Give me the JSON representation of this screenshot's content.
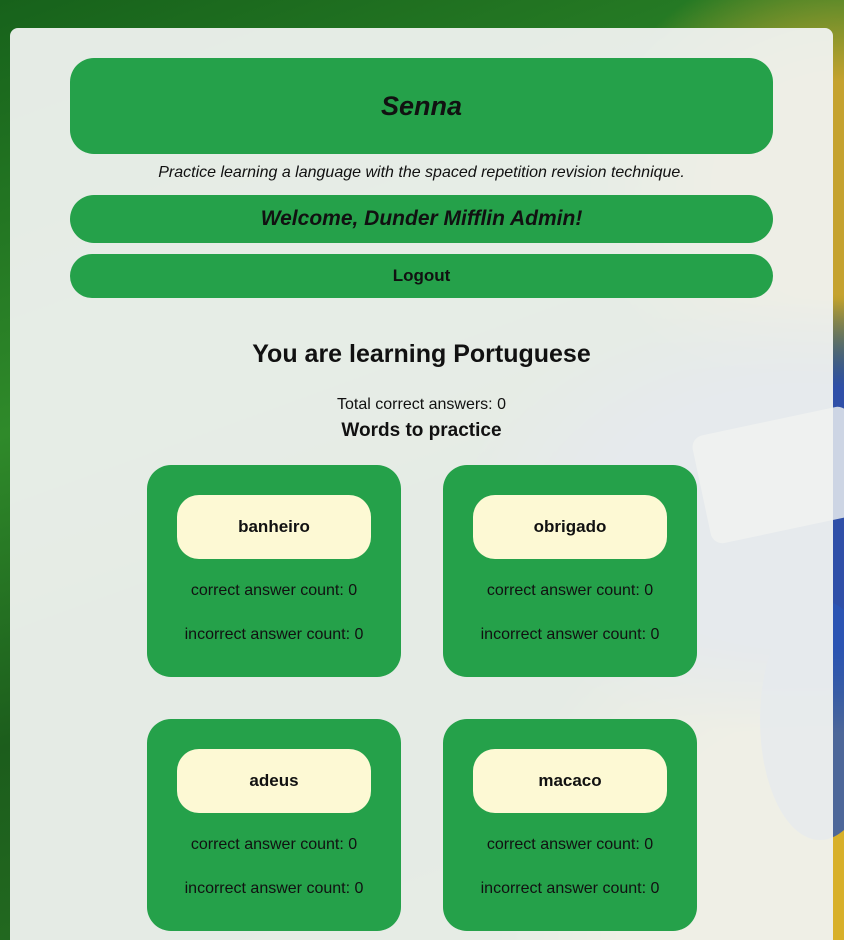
{
  "app": {
    "title": "Senna",
    "tagline": "Practice learning a language with the spaced repetition revision technique.",
    "welcome": "Welcome, Dunder Mifflin Admin!",
    "logout_label": "Logout"
  },
  "dashboard": {
    "learning_heading": "You are learning Portuguese",
    "total_correct": "Total correct answers: 0",
    "words_heading": "Words to practice",
    "words": [
      {
        "word": "banheiro",
        "correct": "correct answer count: 0",
        "incorrect": "incorrect answer count: 0"
      },
      {
        "word": "obrigado",
        "correct": "correct answer count: 0",
        "incorrect": "incorrect answer count: 0"
      },
      {
        "word": "adeus",
        "correct": "correct answer count: 0",
        "incorrect": "incorrect answer count: 0"
      },
      {
        "word": "macaco",
        "correct": "correct answer count: 0",
        "incorrect": "incorrect answer count: 0"
      }
    ]
  },
  "colors": {
    "accent_green": "#25a14a",
    "word_button_bg": "#fdf9d4",
    "panel_bg": "#f0f2f0"
  }
}
